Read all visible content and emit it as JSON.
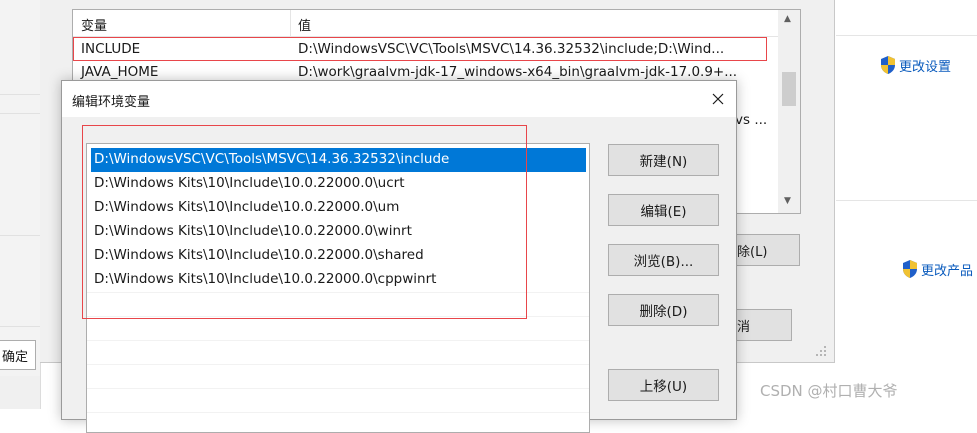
{
  "system_dialog": {
    "ok_label": "确定"
  },
  "right_panel": {
    "change_settings_label": "更改设置",
    "change_product_label": "更改产品"
  },
  "env_dialog": {
    "list_headers": {
      "variable": "变量",
      "value": "值"
    },
    "rows": [
      {
        "name": "INCLUDE",
        "value": "D:\\WindowsVSC\\VC\\Tools\\MSVC\\14.36.32532\\include;D:\\Wind..."
      },
      {
        "name": "JAVA_HOME",
        "value": "D:\\work\\graalvm-jdk-17_windows-x64_bin\\graalvm-jdk-17.0.9+..."
      }
    ],
    "peek_text": "vs ...",
    "delete_label": "除(L)",
    "cancel_label": "消"
  },
  "edit_dialog": {
    "title": "编辑环境变量",
    "entries": [
      "D:\\WindowsVSC\\VC\\Tools\\MSVC\\14.36.32532\\include",
      "D:\\Windows Kits\\10\\Include\\10.0.22000.0\\ucrt",
      "D:\\Windows Kits\\10\\Include\\10.0.22000.0\\um",
      "D:\\Windows Kits\\10\\Include\\10.0.22000.0\\winrt",
      "D:\\Windows Kits\\10\\Include\\10.0.22000.0\\shared",
      "D:\\Windows Kits\\10\\Include\\10.0.22000.0\\cppwinrt"
    ],
    "buttons": {
      "new": "新建(N)",
      "edit": "编辑(E)",
      "browse": "浏览(B)...",
      "delete": "删除(D)",
      "move_up": "上移(U)"
    }
  },
  "watermark": "CSDN @村口曹大爷",
  "colors": {
    "selection": "#0078d7",
    "highlight_box": "#e8464a",
    "dialog_bg": "#f0f0f0",
    "link": "#0a5bbd"
  }
}
